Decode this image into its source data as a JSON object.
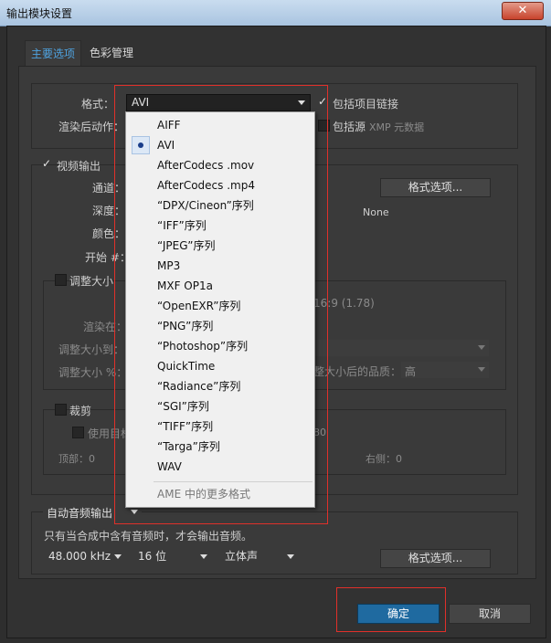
{
  "window": {
    "title": "输出模块设置",
    "close_glyph": "✕"
  },
  "tabs": [
    {
      "label": "主要选项",
      "active": true
    },
    {
      "label": "色彩管理",
      "active": false
    }
  ],
  "main": {
    "format_label": "格式：",
    "format_value": "AVI",
    "include_project_link": "包括项目链接",
    "post_render_label": "渲染后动作：",
    "include_source": "包括源",
    "xmp_metadata": "XMP 元数据"
  },
  "video": {
    "header": "视频输出",
    "channel_label": "通道：",
    "depth_label": "深度：",
    "color_label": "颜色：",
    "start_label": "开始 #：",
    "format_options_btn": "格式选项...",
    "none_text": "None",
    "resize_label": "调整大小",
    "aspect_text": "16:9 (1.78)",
    "render_at_label": "渲染在：",
    "resize_to_label": "调整大小到：",
    "resize_pct_label": "调整大小 %：",
    "quality_label": "整大小后的品质：",
    "quality_value": "高",
    "crop_label": "裁剪",
    "use_roi_label": "使用目标",
    "crop_num": "80",
    "top_label": "顶部：0",
    "right_label": "右侧：0"
  },
  "audio": {
    "output_label": "自动音频输出",
    "note": "只有当合成中含有音频时，才会输出音频。",
    "rate": "48.000 kHz",
    "bits": "16 位",
    "channels": "立体声",
    "format_options_btn": "格式选项..."
  },
  "footer": {
    "ok": "确定",
    "cancel": "取消"
  },
  "format_menu": {
    "items": [
      {
        "label": "AIFF"
      },
      {
        "label": "AVI",
        "selected": true
      },
      {
        "label": "AfterCodecs .mov"
      },
      {
        "label": "AfterCodecs .mp4"
      },
      {
        "label": "“DPX/Cineon”序列"
      },
      {
        "label": "“IFF”序列"
      },
      {
        "label": "“JPEG”序列"
      },
      {
        "label": "MP3"
      },
      {
        "label": "MXF OP1a"
      },
      {
        "label": "“OpenEXR”序列"
      },
      {
        "label": "“PNG”序列"
      },
      {
        "label": "“Photoshop”序列"
      },
      {
        "label": "QuickTime"
      },
      {
        "label": "“Radiance”序列"
      },
      {
        "label": "“SGI”序列"
      },
      {
        "label": "“TIFF”序列"
      },
      {
        "label": "“Targa”序列"
      },
      {
        "label": "WAV"
      }
    ],
    "more": "AME 中的更多格式"
  },
  "colors": {
    "accent": "#4fa3e0",
    "ok_button": "#1f6aa0",
    "highlight_box": "#e0302a"
  }
}
